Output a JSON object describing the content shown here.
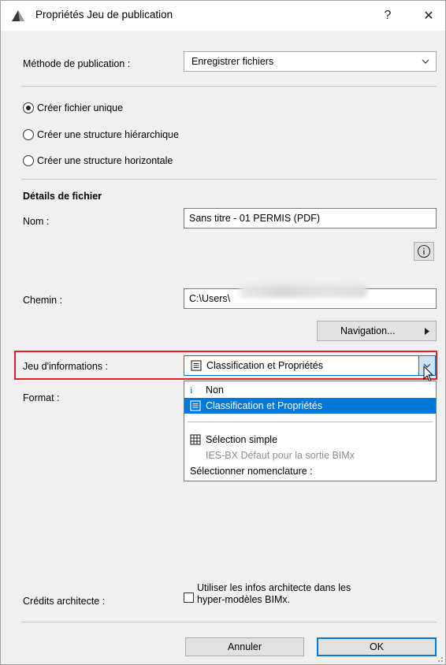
{
  "window": {
    "title": "Propriétés Jeu de publication",
    "help_label": "?",
    "close_label": "✕"
  },
  "method": {
    "label": "Méthode de publication :",
    "value": "Enregistrer fichiers"
  },
  "structure_options": [
    {
      "label": "Créer fichier unique",
      "selected": true
    },
    {
      "label": "Créer une structure hiérarchique",
      "selected": false
    },
    {
      "label": "Créer une structure horizontale",
      "selected": false
    }
  ],
  "file_details": {
    "heading": "Détails de fichier",
    "name_label": "Nom :",
    "name_value": "Sans titre - 01 PERMIS (PDF)",
    "info_button_label": "i",
    "path_label": "Chemin :",
    "path_value": "C:\\Users\\",
    "browse_label": "Navigation..."
  },
  "info_set": {
    "label": "Jeu d'informations :",
    "value": "Classification et Propriétés",
    "options": [
      {
        "label": "Non",
        "icon": "info-icon",
        "state": "normal"
      },
      {
        "label": "Classification et Propriétés",
        "icon": "document-icon",
        "state": "selected"
      },
      {
        "label": "Sélection simple",
        "icon": "table-icon",
        "state": "normal"
      },
      {
        "label": "IES-BX Défaut pour la sortie BIMx",
        "icon": "",
        "state": "disabled"
      },
      {
        "label": "Sélectionner nomenclature :",
        "icon": "",
        "state": "normal"
      }
    ]
  },
  "format": {
    "label": "Format :"
  },
  "architect": {
    "label": "Crédits architecte :",
    "checkbox_line1": "Utiliser les infos architecte dans les",
    "checkbox_line2": "hyper-modèles BIMx.",
    "checked": false
  },
  "footer": {
    "cancel_label": "Annuler",
    "ok_label": "OK"
  },
  "colors": {
    "accent": "#0078d7",
    "highlight_border": "#e0202a"
  }
}
